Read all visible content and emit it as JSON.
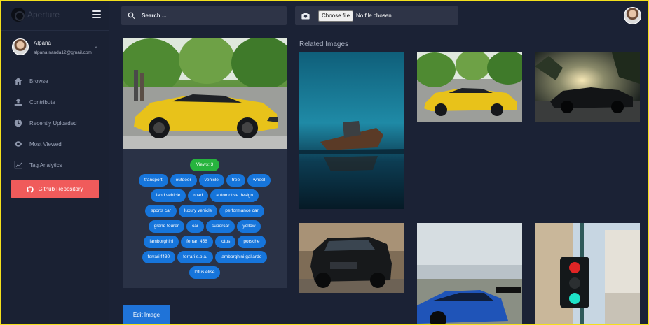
{
  "brand": {
    "name": "Aperture",
    "logo_icon": "aperture-logo"
  },
  "user": {
    "name": "Alpana",
    "email": "alpana.nanda12@gmail.com"
  },
  "nav": [
    {
      "label": "Browse",
      "icon": "home-icon"
    },
    {
      "label": "Contribute",
      "icon": "upload-icon"
    },
    {
      "label": "Recently Uploaded",
      "icon": "clock-icon"
    },
    {
      "label": "Most Viewed",
      "icon": "eye-icon"
    },
    {
      "label": "Tag Analytics",
      "icon": "chart-icon"
    }
  ],
  "github_button": {
    "label": "Github Repository"
  },
  "search": {
    "placeholder": "Search ..."
  },
  "upload": {
    "choose_label": "Choose file",
    "status": "No file chosen"
  },
  "card": {
    "views": "Views: 3",
    "tag_rows": [
      [
        "transport",
        "outdoor",
        "vehicle",
        "tree",
        "wheel"
      ],
      [
        "land vehicle",
        "road",
        "automotive design"
      ],
      [
        "sports car",
        "luxury vehicle",
        "performance car"
      ],
      [
        "grand tourer",
        "car",
        "supercar",
        "yellow"
      ],
      [
        "lamborghini",
        "ferrari 458",
        "lotus",
        "porsche"
      ],
      [
        "ferrari f430",
        "ferrari s.p.a.",
        "lamborghini gallardo"
      ],
      [
        "lotus elise"
      ]
    ]
  },
  "edit_button": {
    "label": "Edit Image"
  },
  "related": {
    "title": "Related Images"
  },
  "colors": {
    "background": "#1B2235",
    "accent_blue": "#1675DB",
    "views_green": "#27B43E",
    "github_red": "#F05B5B",
    "border_yellow": "#F4E01C"
  }
}
